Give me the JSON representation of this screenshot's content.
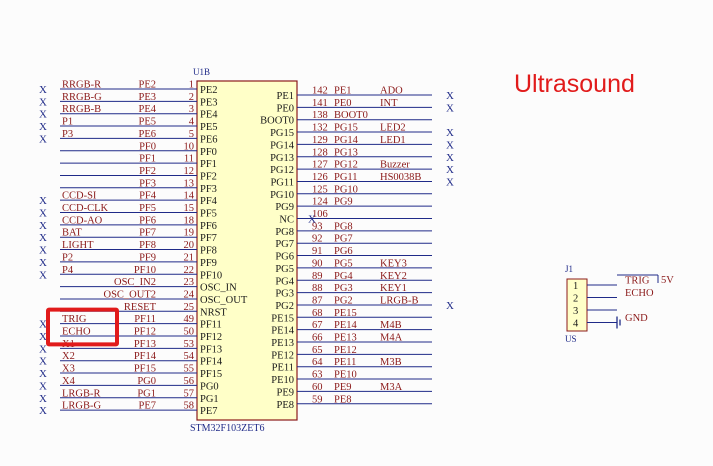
{
  "title": "Ultrasound",
  "chip": {
    "ref": "U1B",
    "part": "STM32F103ZET6",
    "left_pins": [
      {
        "pin": "PE2",
        "num": "1",
        "port": "PE2",
        "net": "RRGB-R",
        "nc": true
      },
      {
        "pin": "PE3",
        "num": "2",
        "port": "PE3",
        "net": "RRGB-G",
        "nc": true
      },
      {
        "pin": "PE4",
        "num": "3",
        "port": "PE4",
        "net": "RRGB-B",
        "nc": true
      },
      {
        "pin": "PE5",
        "num": "4",
        "port": "PE5",
        "net": "P1",
        "nc": true
      },
      {
        "pin": "PE6",
        "num": "5",
        "port": "PE6",
        "net": "P3",
        "nc": true
      },
      {
        "pin": "PF0",
        "num": "10",
        "port": "PF0",
        "net": "",
        "nc": false
      },
      {
        "pin": "PF1",
        "num": "11",
        "port": "PF1",
        "net": "",
        "nc": false
      },
      {
        "pin": "PF2",
        "num": "12",
        "port": "PF2",
        "net": "",
        "nc": false
      },
      {
        "pin": "PF3",
        "num": "13",
        "port": "PF3",
        "net": "",
        "nc": false
      },
      {
        "pin": "PF4",
        "num": "14",
        "port": "PF4",
        "net": "CCD-SI",
        "nc": true
      },
      {
        "pin": "PF5",
        "num": "15",
        "port": "PF5",
        "net": "CCD-CLK",
        "nc": true
      },
      {
        "pin": "PF6",
        "num": "18",
        "port": "PF6",
        "net": "CCD-AO",
        "nc": true
      },
      {
        "pin": "PF7",
        "num": "19",
        "port": "PF7",
        "net": "BAT",
        "nc": true
      },
      {
        "pin": "PF8",
        "num": "20",
        "port": "PF8",
        "net": "LIGHT",
        "nc": true
      },
      {
        "pin": "PF9",
        "num": "21",
        "port": "PF9",
        "net": "P2",
        "nc": true
      },
      {
        "pin": "PF10",
        "num": "22",
        "port": "PF10",
        "net": "P4",
        "nc": true
      },
      {
        "pin": "OSC_IN",
        "num": "23",
        "port": "OSC_IN2",
        "net": "",
        "nc": false
      },
      {
        "pin": "OSC_OUT",
        "num": "24",
        "port": "OSC_OUT2",
        "net": "",
        "nc": false
      },
      {
        "pin": "NRST",
        "num": "25",
        "port": "RESET",
        "net": "",
        "nc": false
      },
      {
        "pin": "PF11",
        "num": "49",
        "port": "PF11",
        "net": "TRIG",
        "nc": true
      },
      {
        "pin": "PF12",
        "num": "50",
        "port": "PF12",
        "net": "ECHO",
        "nc": true
      },
      {
        "pin": "PF13",
        "num": "53",
        "port": "PF13",
        "net": "X1",
        "nc": true
      },
      {
        "pin": "PF14",
        "num": "54",
        "port": "PF14",
        "net": "X2",
        "nc": true
      },
      {
        "pin": "PF15",
        "num": "55",
        "port": "PF15",
        "net": "X3",
        "nc": true
      },
      {
        "pin": "PG0",
        "num": "56",
        "port": "PG0",
        "net": "X4",
        "nc": true
      },
      {
        "pin": "PG1",
        "num": "57",
        "port": "PG1",
        "net": "LRGB-R",
        "nc": true
      },
      {
        "pin": "PE7",
        "num": "58",
        "port": "PE7",
        "net": "LRGB-G",
        "nc": true
      }
    ],
    "right_pins": [
      {
        "pin": "PE1",
        "num": "142",
        "port": "PE1",
        "net": "ADO",
        "nc": true
      },
      {
        "pin": "PE0",
        "num": "141",
        "port": "PE0",
        "net": "INT",
        "nc": true
      },
      {
        "pin": "BOOT0",
        "num": "138",
        "port": "BOOT0",
        "net": "",
        "nc": false
      },
      {
        "pin": "PG15",
        "num": "132",
        "port": "PG15",
        "net": "LED2",
        "nc": true
      },
      {
        "pin": "PG14",
        "num": "129",
        "port": "PG14",
        "net": "LED1",
        "nc": true
      },
      {
        "pin": "PG13",
        "num": "128",
        "port": "PG13",
        "net": "",
        "nc": true
      },
      {
        "pin": "PG12",
        "num": "127",
        "port": "PG12",
        "net": "Buzzer",
        "nc": true
      },
      {
        "pin": "PG11",
        "num": "126",
        "port": "PG11",
        "net": "HS0038B",
        "nc": true
      },
      {
        "pin": "PG10",
        "num": "125",
        "port": "PG10",
        "net": "",
        "nc": false
      },
      {
        "pin": "PG9",
        "num": "124",
        "port": "PG9",
        "net": "",
        "nc": false
      },
      {
        "pin": "NC",
        "num": "106",
        "port": "",
        "net": "",
        "nc": false
      },
      {
        "pin": "PG8",
        "num": "93",
        "port": "PG8",
        "net": "",
        "nc": false
      },
      {
        "pin": "PG7",
        "num": "92",
        "port": "PG7",
        "net": "",
        "nc": false
      },
      {
        "pin": "PG6",
        "num": "91",
        "port": "PG6",
        "net": "",
        "nc": false
      },
      {
        "pin": "PG5",
        "num": "90",
        "port": "PG5",
        "net": "KEY3",
        "nc": false
      },
      {
        "pin": "PG4",
        "num": "89",
        "port": "PG4",
        "net": "KEY2",
        "nc": false
      },
      {
        "pin": "PG3",
        "num": "88",
        "port": "PG3",
        "net": "KEY1",
        "nc": false
      },
      {
        "pin": "PG2",
        "num": "87",
        "port": "PG2",
        "net": "LRGB-B",
        "nc": true
      },
      {
        "pin": "PE15",
        "num": "68",
        "port": "PE15",
        "net": "",
        "nc": false
      },
      {
        "pin": "PE14",
        "num": "67",
        "port": "PE14",
        "net": "M4B",
        "nc": false
      },
      {
        "pin": "PE13",
        "num": "66",
        "port": "PE13",
        "net": "M4A",
        "nc": false
      },
      {
        "pin": "PE12",
        "num": "65",
        "port": "PE12",
        "net": "",
        "nc": false
      },
      {
        "pin": "PE11",
        "num": "64",
        "port": "PE11",
        "net": "M3B",
        "nc": false
      },
      {
        "pin": "PE10",
        "num": "63",
        "port": "PE10",
        "net": "",
        "nc": false
      },
      {
        "pin": "PE9",
        "num": "60",
        "port": "PE9",
        "net": "M3A",
        "nc": false
      },
      {
        "pin": "PE8",
        "num": "59",
        "port": "PE8",
        "net": "",
        "nc": false
      }
    ]
  },
  "connector": {
    "ref": "J1",
    "part": "US",
    "pins": [
      "1",
      "2",
      "3",
      "4"
    ],
    "labels": [
      "TRIG",
      "ECHO",
      "",
      "GND"
    ],
    "power": "5V"
  },
  "highlight_color": "#e11b1b",
  "nc_mark": "X"
}
